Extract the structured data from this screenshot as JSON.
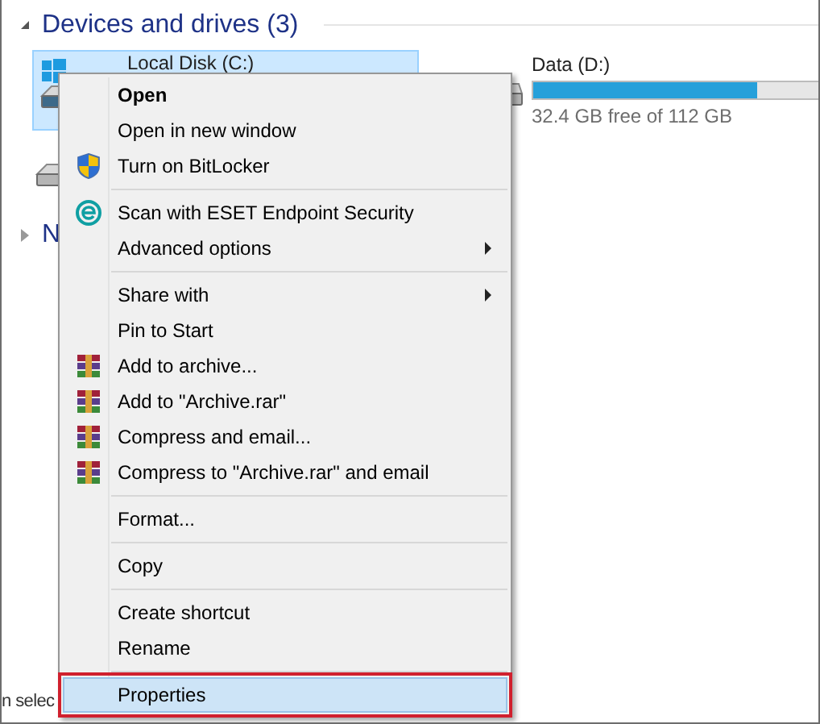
{
  "section": {
    "title": "Devices and drives (3)",
    "expanded": true
  },
  "drives": [
    {
      "label": "Local Disk (C:)",
      "selected": true,
      "kind": "system"
    },
    {
      "label": "Data (D:)",
      "selected": false,
      "kind": "data",
      "level": 0.74,
      "free": "32.4 GB free of 112 GB"
    }
  ],
  "next_section": {
    "title": "N",
    "expanded": false
  },
  "status_bar": {
    "text": "n selec"
  },
  "context_menu": [
    {
      "kind": "plain",
      "label": "Open",
      "bold": true,
      "selected": false
    },
    {
      "kind": "plain",
      "label": "Open in new window",
      "selected": false
    },
    {
      "kind": "shield",
      "label": "Turn on BitLocker",
      "selected": false
    },
    {
      "kind": "separator"
    },
    {
      "kind": "eset",
      "label": "Scan with ESET Endpoint Security",
      "selected": false
    },
    {
      "kind": "plain",
      "label": "Advanced options",
      "submenu": true,
      "selected": false
    },
    {
      "kind": "separator"
    },
    {
      "kind": "plain",
      "label": "Share with",
      "submenu": true,
      "selected": false
    },
    {
      "kind": "plain",
      "label": "Pin to Start",
      "selected": false
    },
    {
      "kind": "archive",
      "label": "Add to archive...",
      "selected": false
    },
    {
      "kind": "archive",
      "label": "Add to \"Archive.rar\"",
      "selected": false
    },
    {
      "kind": "archive",
      "label": "Compress and email...",
      "selected": false
    },
    {
      "kind": "archive",
      "label": "Compress to \"Archive.rar\" and email",
      "selected": false
    },
    {
      "kind": "separator"
    },
    {
      "kind": "plain",
      "label": "Format...",
      "selected": false
    },
    {
      "kind": "separator"
    },
    {
      "kind": "plain",
      "label": "Copy",
      "selected": false
    },
    {
      "kind": "separator"
    },
    {
      "kind": "plain",
      "label": "Create shortcut",
      "selected": false
    },
    {
      "kind": "plain",
      "label": "Rename",
      "selected": false
    },
    {
      "kind": "separator"
    },
    {
      "kind": "plain",
      "label": "Properties",
      "selected": true,
      "outlined": true
    }
  ]
}
